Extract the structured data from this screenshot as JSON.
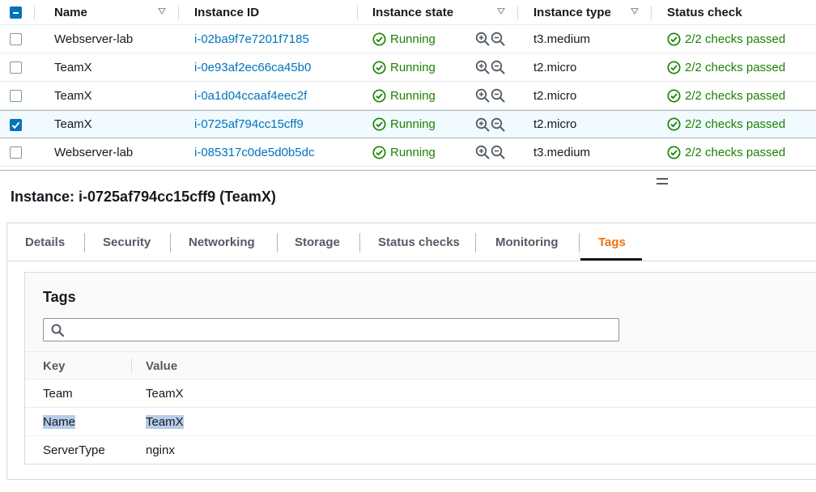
{
  "table": {
    "headers": {
      "name": "Name",
      "instance_id": "Instance ID",
      "instance_state": "Instance state",
      "instance_type": "Instance type",
      "status_check": "Status check"
    },
    "rows": [
      {
        "name": "Webserver-lab",
        "id": "i-02ba9f7e7201f7185",
        "state": "Running",
        "type": "t3.medium",
        "status": "2/2 checks passed",
        "selected": false
      },
      {
        "name": "TeamX",
        "id": "i-0e93af2ec66ca45b0",
        "state": "Running",
        "type": "t2.micro",
        "status": "2/2 checks passed",
        "selected": false
      },
      {
        "name": "TeamX",
        "id": "i-0a1d04ccaaf4eec2f",
        "state": "Running",
        "type": "t2.micro",
        "status": "2/2 checks passed",
        "selected": false
      },
      {
        "name": "TeamX",
        "id": "i-0725af794cc15cff9",
        "state": "Running",
        "type": "t2.micro",
        "status": "2/2 checks passed",
        "selected": true
      },
      {
        "name": "Webserver-lab",
        "id": "i-085317c0de5d0b5dc",
        "state": "Running",
        "type": "t3.medium",
        "status": "2/2 checks passed",
        "selected": false
      }
    ]
  },
  "detail": {
    "title": "Instance: i-0725af794cc15cff9 (TeamX)",
    "tabs": [
      "Details",
      "Security",
      "Networking",
      "Storage",
      "Status checks",
      "Monitoring",
      "Tags"
    ],
    "active_tab": "Tags"
  },
  "tags": {
    "title": "Tags",
    "search_placeholder": "",
    "col_key": "Key",
    "col_value": "Value",
    "rows": [
      {
        "key": "Team",
        "value": "TeamX"
      },
      {
        "key": "Name",
        "value": "TeamX"
      },
      {
        "key": "ServerType",
        "value": "nginx"
      }
    ]
  },
  "colors": {
    "link": "#0073bb",
    "success": "#1d8102",
    "active_tab": "#ec7211",
    "checkbox": "#0073bb"
  }
}
